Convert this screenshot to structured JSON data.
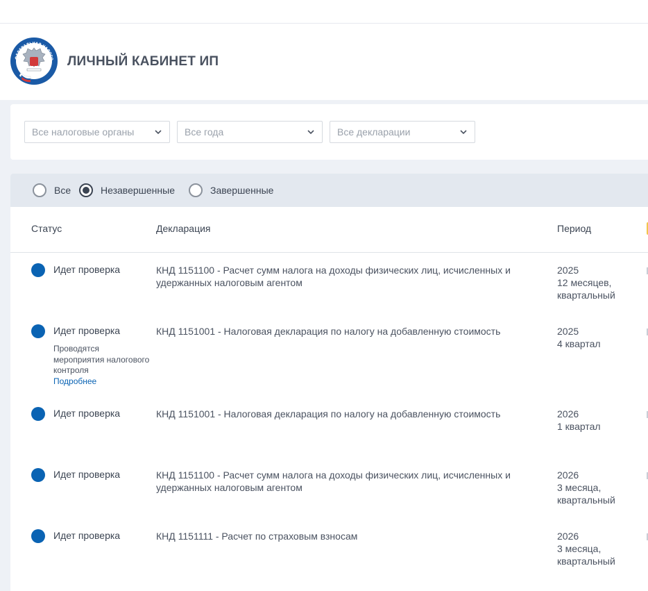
{
  "header": {
    "title": "ЛИЧНЫЙ КАБИНЕТ ИП",
    "logo_text": "ФЕДЕРАЛЬНАЯ НАЛОГОВАЯ СЛУЖБА"
  },
  "filters": {
    "tax_authority": "Все налоговые органы",
    "year": "Все года",
    "declaration": "Все декларации"
  },
  "status_filter": {
    "options": [
      "Все",
      "Незавершенные",
      "Завершенные"
    ],
    "selected": "Незавершенные"
  },
  "table": {
    "columns": [
      "Статус",
      "Декларация",
      "Период"
    ],
    "rows": [
      {
        "status": "Идет проверка",
        "declaration": "КНД 1151100 - Расчет сумм налога на доходы физических лиц, исчисленных и удержанных налоговым агентом",
        "period_year": "2025",
        "period_detail_1": "12 месяцев,",
        "period_detail_2": "квартальный"
      },
      {
        "status": "Идет проверка",
        "status_note": "Проводятся мероприятия налогового контроля",
        "status_link": "Подробнее",
        "declaration": "КНД 1151001 - Налоговая декларация по налогу на добавленную стоимость",
        "period_year": "2025",
        "period_detail_1": "4 квартал",
        "period_detail_2": ""
      },
      {
        "status": "Идет проверка",
        "declaration": "КНД 1151001 - Налоговая декларация по налогу на добавленную стоимость",
        "period_year": "2026",
        "period_detail_1": "1 квартал",
        "period_detail_2": ""
      },
      {
        "status": "Идет проверка",
        "declaration": "КНД 1151100 - Расчет сумм налога на доходы физических лиц, исчисленных и удержанных налоговым агентом",
        "period_year": "2026",
        "period_detail_1": "3 месяца,",
        "period_detail_2": "квартальный"
      },
      {
        "status": "Идет проверка",
        "declaration": "КНД 1151111 - Расчет по страховым взносам",
        "period_year": "2026",
        "period_detail_1": "3 месяца,",
        "period_detail_2": "квартальный"
      }
    ]
  },
  "colors": {
    "status_in_progress": "#0a63b3",
    "link": "#0a63b3",
    "accent": "#f3c64b"
  },
  "icons": {
    "logo": "fns-emblem-icon",
    "dropdown": "chevron-down-icon",
    "status": "status-dot-icon"
  }
}
